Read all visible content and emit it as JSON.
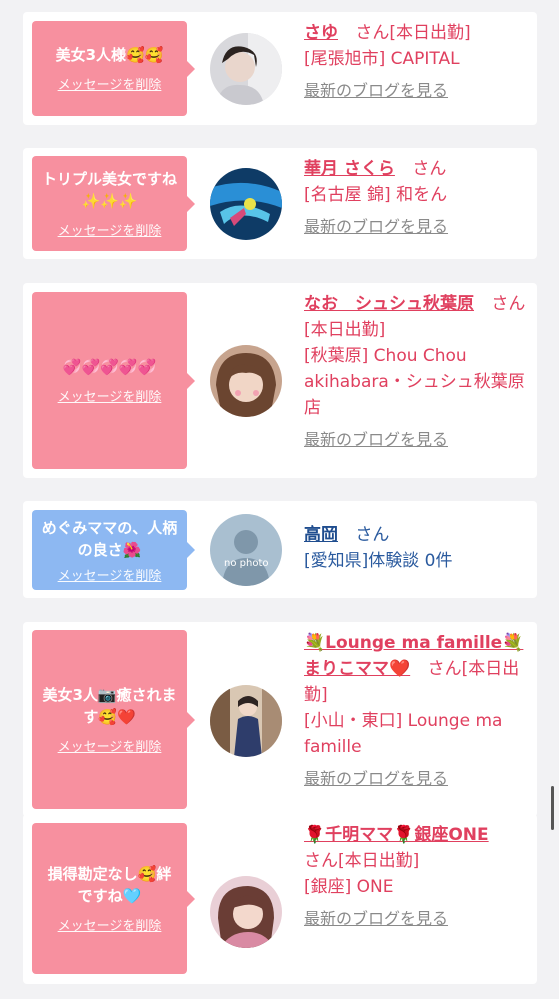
{
  "cards": [
    {
      "bubble_text": "美女3人様🥰🥰",
      "delete_label": "メッセージを削除",
      "name": "さゆ",
      "san": "さん",
      "status": "[本日出勤]",
      "shop": "[尾張旭市] CAPITAL",
      "blog": "最新のブログを見る"
    },
    {
      "bubble_text": "トリプル美女ですね✨✨✨",
      "delete_label": "メッセージを削除",
      "name": "華月 さくら",
      "san": "さん",
      "status": "",
      "shop": "[名古屋 錦] 和をん",
      "blog": "最新のブログを見る"
    },
    {
      "bubble_text": "💞💞💞💞💞",
      "delete_label": "メッセージを削除",
      "name": "なお　シュシュ秋葉原",
      "san": "さん",
      "status": "[本日出勤]",
      "shop": "[秋葉原] Chou Chou akihabara・シュシュ秋葉原店",
      "blog": "最新のブログを見る"
    },
    {
      "bubble_text": "めぐみママの、人柄の良さ🌺",
      "delete_label": "メッセージを削除",
      "name": "高岡",
      "san": "さん",
      "status": "",
      "shop": "[愛知県]体験談 0件",
      "blog": "",
      "avatar_text": "no photo"
    },
    {
      "bubble_text": "美女3人📷癒されます🥰❤️",
      "delete_label": "メッセージを削除",
      "name": "💐Lounge ma famille💐まりこママ❤️",
      "san": "さん",
      "status": "[本日出勤]",
      "shop": "[小山・東口] Lounge ma famille",
      "blog": "最新のブログを見る"
    },
    {
      "bubble_text": "損得勘定なし🥰絆ですね🩵",
      "delete_label": "メッセージを削除",
      "name": "🌹千明ママ🌹銀座ONE",
      "san": "さん",
      "status": "[本日出勤]",
      "shop": "[銀座] ONE",
      "blog": "最新のブログを見る"
    }
  ],
  "colors": {
    "pink_bubble": "#f7909f",
    "blue_bubble": "#8db8f2",
    "name_pink": "#e0405f",
    "name_blue": "#1f4d8f",
    "blog_gray": "#8a8a8a"
  }
}
